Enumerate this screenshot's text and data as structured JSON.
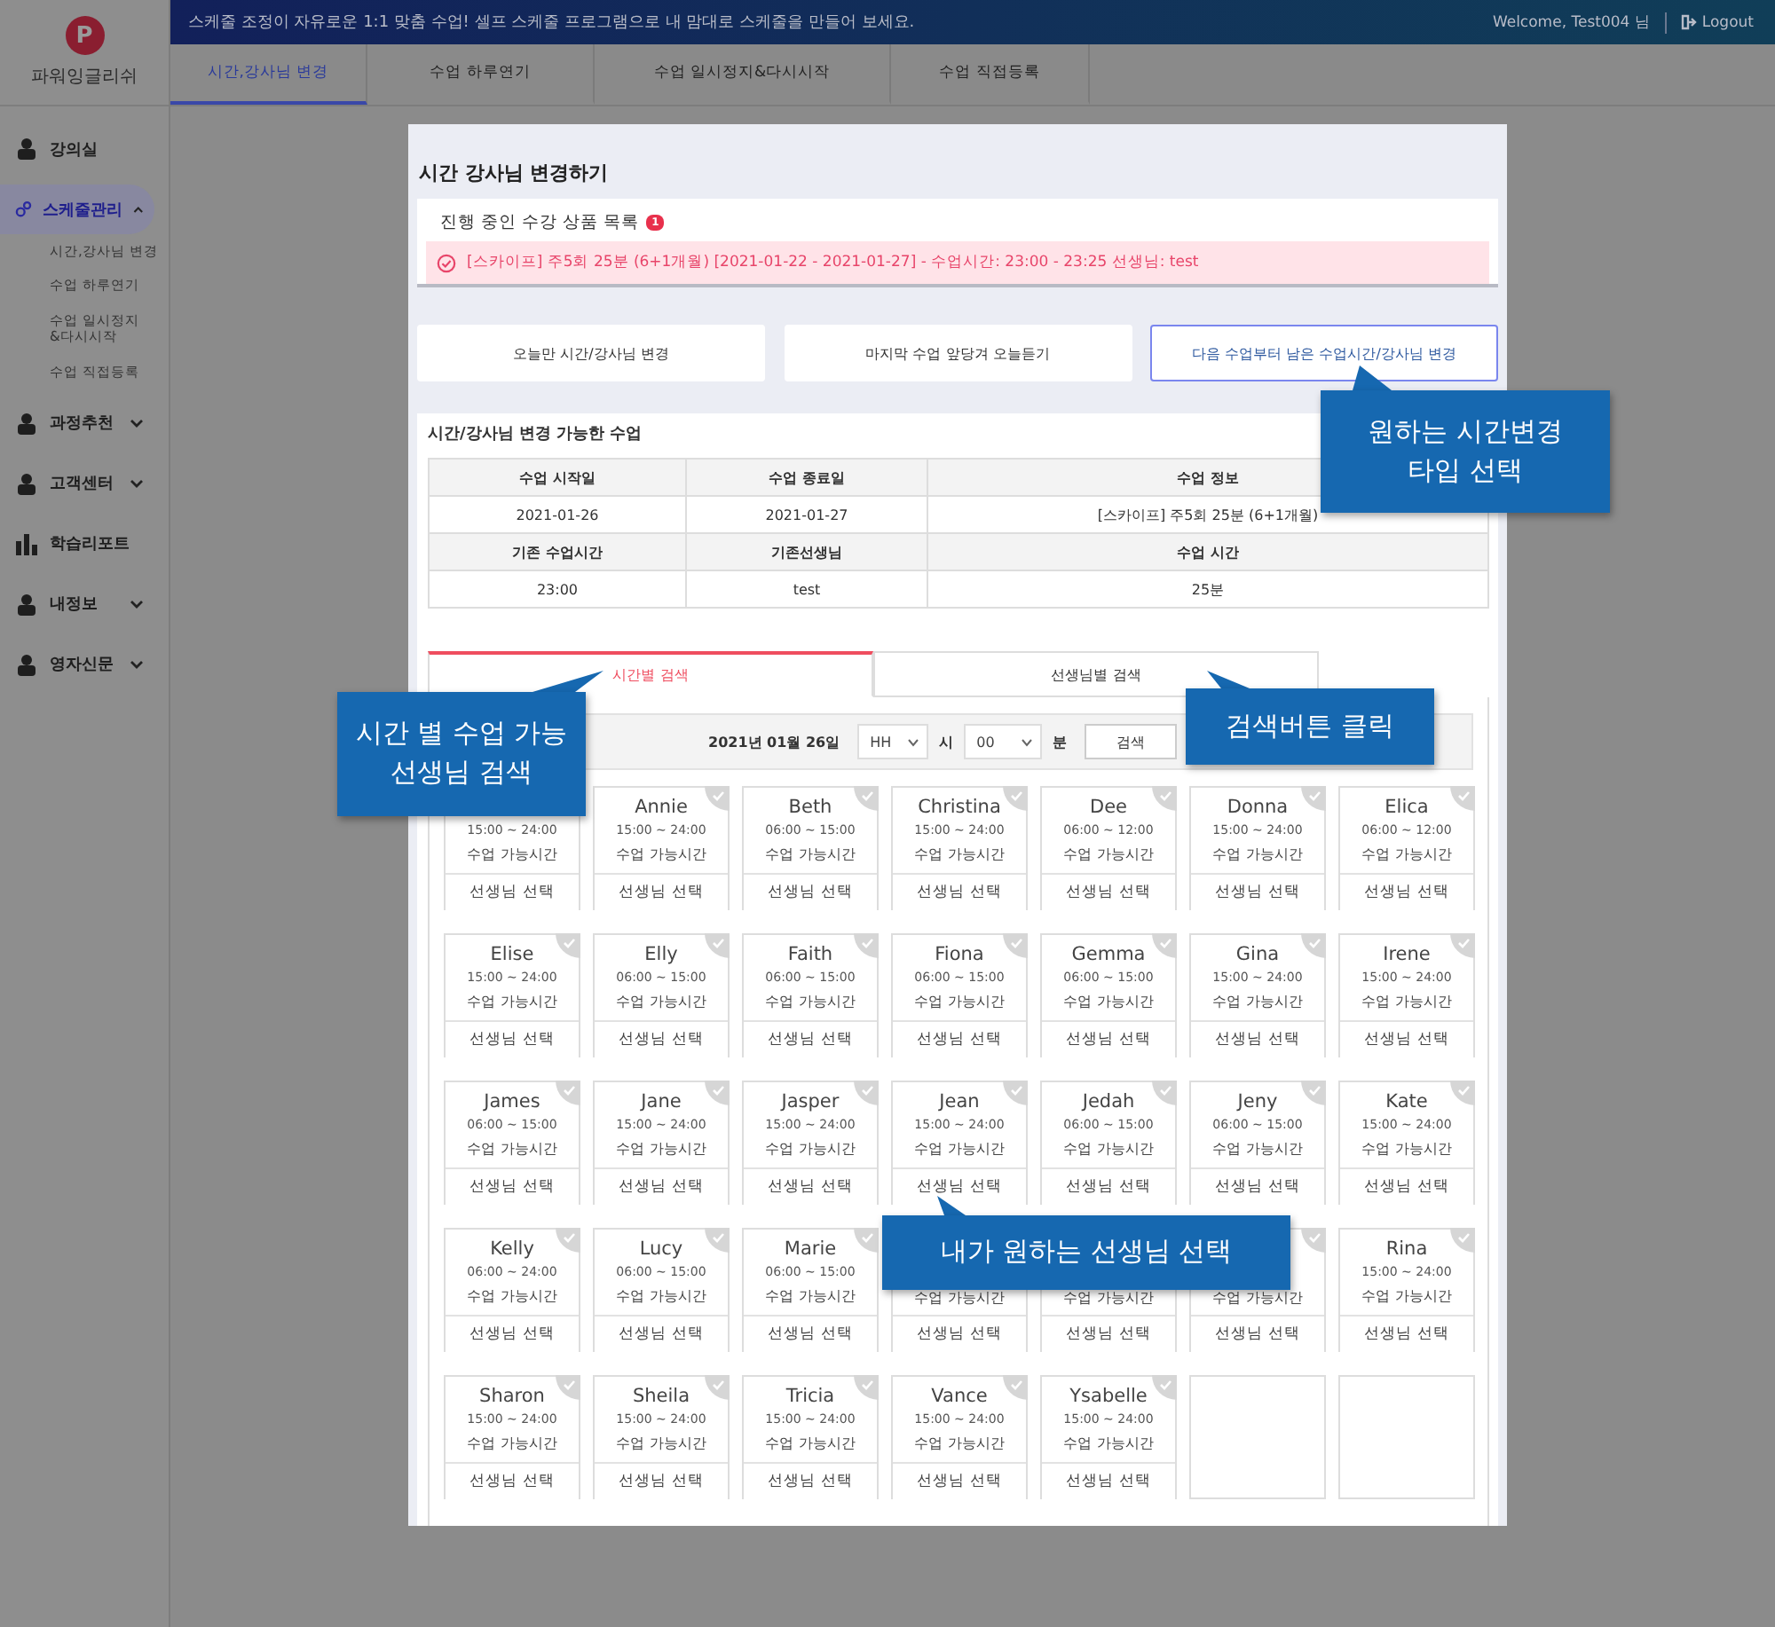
{
  "sidebar": {
    "logo_letter": "P",
    "brand": "파워잉글리쉬",
    "items": [
      {
        "label": "강의실",
        "kind": "link",
        "selected": false
      },
      {
        "label": "스케줄관리",
        "kind": "group",
        "selected": true,
        "expanded": true,
        "children": [
          {
            "label": "시간,강사님 변경"
          },
          {
            "label": "수업 하루연기"
          },
          {
            "label": "수업 일시정지\n&다시시작"
          },
          {
            "label": "수업 직접등록"
          }
        ]
      },
      {
        "label": "과정추천",
        "kind": "group",
        "selected": false,
        "expanded": false
      },
      {
        "label": "고객센터",
        "kind": "group",
        "selected": false,
        "expanded": false
      },
      {
        "label": "학습리포트",
        "kind": "link",
        "selected": false
      },
      {
        "label": "내정보",
        "kind": "group",
        "selected": false,
        "expanded": false
      },
      {
        "label": "영자신문",
        "kind": "group",
        "selected": false,
        "expanded": false
      }
    ]
  },
  "top_bar": {
    "message": "스케줄 조정이 자유로운 1:1 맞춤 수업! 셀프 스케줄 프로그램으로 내 맘대로 스케줄을 만들어 보세요.",
    "welcome": "Welcome, Test004 님",
    "logout": "Logout"
  },
  "nav_tabs": [
    {
      "label": "시간,강사님 변경",
      "selected": true
    },
    {
      "label": "수업 하루연기",
      "selected": false
    },
    {
      "label": "수업 일시정지&다시시작",
      "selected": false
    },
    {
      "label": "수업 직접등록",
      "selected": false
    }
  ],
  "panel": {
    "title": "시간 강사님 변경하기",
    "products": {
      "title": "진행 중인 수강 상품 목록",
      "count": "1",
      "items": [
        "[스카이프] 주5회 25분 (6+1개월) [2021-01-22 - 2021-01-27] - 수업시간: 23:00 - 23:25 선생님: test"
      ]
    },
    "modes": [
      {
        "label": "오늘만 시간/강사님 변경",
        "selected": false
      },
      {
        "label": "마지막 수업 앞당겨 오늘듣기",
        "selected": false
      },
      {
        "label": "다음 수업부터 남은 수업시간/강사님 변경",
        "selected": true
      }
    ],
    "section_title": "시간/강사님 변경 가능한 수업",
    "table": [
      {
        "kind": "header",
        "cells": [
          "수업 시작일",
          "수업 종료일",
          "수업 정보"
        ]
      },
      {
        "kind": "data",
        "cells": [
          "2021-01-26",
          "2021-01-27",
          "[스카이프] 주5회 25분 (6+1개월)"
        ]
      },
      {
        "kind": "header",
        "cells": [
          "기존 수업시간",
          "기존선생님",
          "수업 시간"
        ]
      },
      {
        "kind": "data",
        "cells": [
          "23:00",
          "test",
          "25분"
        ]
      }
    ],
    "search_tabs": [
      {
        "label": "시간별 검색",
        "selected": true
      },
      {
        "label": "선생님별 검색",
        "selected": false
      }
    ],
    "search": {
      "date": "2021년 01월 26일",
      "hour": "HH",
      "hour_unit": "시",
      "minute": "00",
      "minute_unit": "분",
      "button": "검색"
    },
    "teachers": [
      {
        "kind": "teacher",
        "hours": "15:00 ~ 24:00",
        "availability": "수업 가능시간",
        "action": "선생님 선택"
      },
      {
        "kind": "teacher",
        "name": "Annie",
        "hours": "15:00 ~ 24:00",
        "availability": "수업 가능시간",
        "action": "선생님 선택"
      },
      {
        "kind": "teacher",
        "name": "Beth",
        "hours": "06:00 ~ 15:00",
        "availability": "수업 가능시간",
        "action": "선생님 선택"
      },
      {
        "kind": "teacher",
        "name": "Christina",
        "hours": "15:00 ~ 24:00",
        "availability": "수업 가능시간",
        "action": "선생님 선택"
      },
      {
        "kind": "teacher",
        "name": "Dee",
        "hours": "06:00 ~ 12:00",
        "availability": "수업 가능시간",
        "action": "선생님 선택"
      },
      {
        "kind": "teacher",
        "name": "Donna",
        "hours": "15:00 ~ 24:00",
        "availability": "수업 가능시간",
        "action": "선생님 선택"
      },
      {
        "kind": "teacher",
        "name": "Elica",
        "hours": "06:00 ~ 12:00",
        "availability": "수업 가능시간",
        "action": "선생님 선택"
      },
      {
        "kind": "teacher",
        "name": "Elise",
        "hours": "15:00 ~ 24:00",
        "availability": "수업 가능시간",
        "action": "선생님 선택"
      },
      {
        "kind": "teacher",
        "name": "Elly",
        "hours": "06:00 ~ 15:00",
        "availability": "수업 가능시간",
        "action": "선생님 선택"
      },
      {
        "kind": "teacher",
        "name": "Faith",
        "hours": "06:00 ~ 15:00",
        "availability": "수업 가능시간",
        "action": "선생님 선택"
      },
      {
        "kind": "teacher",
        "name": "Fiona",
        "hours": "06:00 ~ 15:00",
        "availability": "수업 가능시간",
        "action": "선생님 선택"
      },
      {
        "kind": "teacher",
        "name": "Gemma",
        "hours": "06:00 ~ 15:00",
        "availability": "수업 가능시간",
        "action": "선생님 선택"
      },
      {
        "kind": "teacher",
        "name": "Gina",
        "hours": "15:00 ~ 24:00",
        "availability": "수업 가능시간",
        "action": "선생님 선택"
      },
      {
        "kind": "teacher",
        "name": "Irene",
        "hours": "15:00 ~ 24:00",
        "availability": "수업 가능시간",
        "action": "선생님 선택"
      },
      {
        "kind": "teacher",
        "name": "James",
        "hours": "06:00 ~ 15:00",
        "availability": "수업 가능시간",
        "action": "선생님 선택"
      },
      {
        "kind": "teacher",
        "name": "Jane",
        "hours": "15:00 ~ 24:00",
        "availability": "수업 가능시간",
        "action": "선생님 선택"
      },
      {
        "kind": "teacher",
        "name": "Jasper",
        "hours": "15:00 ~ 24:00",
        "availability": "수업 가능시간",
        "action": "선생님 선택"
      },
      {
        "kind": "teacher",
        "name": "Jean",
        "hours": "15:00 ~ 24:00",
        "availability": "수업 가능시간",
        "action": "선생님 선택"
      },
      {
        "kind": "teacher",
        "name": "Jedah",
        "hours": "06:00 ~ 15:00",
        "availability": "수업 가능시간",
        "action": "선생님 선택"
      },
      {
        "kind": "teacher",
        "name": "Jeny",
        "hours": "06:00 ~ 15:00",
        "availability": "수업 가능시간",
        "action": "선생님 선택"
      },
      {
        "kind": "teacher",
        "name": "Kate",
        "hours": "15:00 ~ 24:00",
        "availability": "수업 가능시간",
        "action": "선생님 선택"
      },
      {
        "kind": "teacher",
        "name": "Kelly",
        "hours": "06:00 ~ 24:00",
        "availability": "수업 가능시간",
        "action": "선생님 선택"
      },
      {
        "kind": "teacher",
        "name": "Lucy",
        "hours": "06:00 ~ 15:00",
        "availability": "수업 가능시간",
        "action": "선생님 선택"
      },
      {
        "kind": "teacher",
        "name": "Marie",
        "hours": "06:00 ~ 15:00",
        "availability": "수업 가능시간",
        "action": "선생님 선택"
      },
      {
        "kind": "teacher",
        "availability": "수업 가능시간",
        "action": "선생님 선택"
      },
      {
        "kind": "teacher",
        "availability": "수업 가능시간",
        "action": "선생님 선택"
      },
      {
        "kind": "teacher",
        "availability": "수업 가능시간",
        "action": "선생님 선택"
      },
      {
        "kind": "teacher",
        "name": "Rina",
        "hours": "15:00 ~ 24:00",
        "availability": "수업 가능시간",
        "action": "선생님 선택"
      },
      {
        "kind": "teacher",
        "name": "Sharon",
        "hours": "15:00 ~ 24:00",
        "availability": "수업 가능시간",
        "action": "선생님 선택"
      },
      {
        "kind": "teacher",
        "name": "Sheila",
        "hours": "15:00 ~ 24:00",
        "availability": "수업 가능시간",
        "action": "선생님 선택"
      },
      {
        "kind": "teacher",
        "name": "Tricia",
        "hours": "15:00 ~ 24:00",
        "availability": "수업 가능시간",
        "action": "선생님 선택"
      },
      {
        "kind": "teacher",
        "name": "Vance",
        "hours": "15:00 ~ 24:00",
        "availability": "수업 가능시간",
        "action": "선생님 선택"
      },
      {
        "kind": "teacher",
        "name": "Ysabelle",
        "hours": "15:00 ~ 24:00",
        "availability": "수업 가능시간",
        "action": "선생님 선택"
      },
      {
        "kind": "empty"
      },
      {
        "kind": "empty"
      }
    ]
  },
  "callouts": [
    {
      "lines": [
        "원하는 시간변경",
        "타입 선택"
      ]
    },
    {
      "lines": [
        "시간 별 수업 가능",
        "선생님 검색"
      ]
    },
    {
      "lines": [
        "검색버튼 클릭"
      ]
    },
    {
      "lines": [
        "내가 원하는 선생님 선택"
      ]
    }
  ]
}
